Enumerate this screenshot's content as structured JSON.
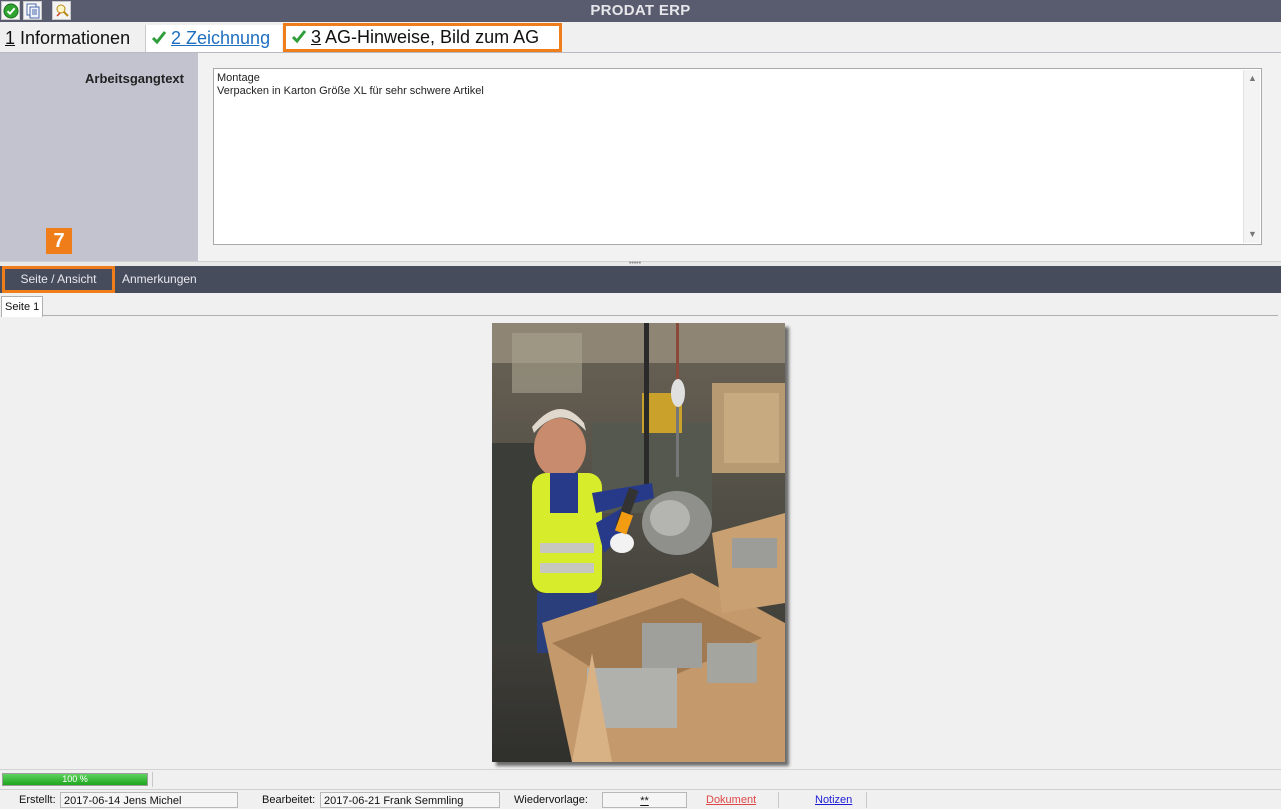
{
  "app": {
    "title": "PRODAT ERP"
  },
  "toolbar": {
    "icons": [
      "ok-check-icon",
      "copy-document-icon",
      "magnify-wand-icon"
    ]
  },
  "tabs": [
    {
      "number": "1",
      "label": " Informationen"
    },
    {
      "number": "2",
      "label": " Zeichnung"
    },
    {
      "number": "3",
      "label": " AG-Hinweise, Bild zum AG"
    }
  ],
  "form": {
    "field_label": "Arbeitsgangtext",
    "text_lines": [
      "Montage",
      "Verpacken in Karton Größe XL für sehr schwere Artikel"
    ]
  },
  "callout": {
    "number": "7"
  },
  "subtabs": {
    "view": "Seite / Ansicht",
    "notes": "Anmerkungen"
  },
  "page_tabs": {
    "page1": "Seite 1"
  },
  "progress": {
    "value_percent": 100,
    "label": "100 %"
  },
  "statusbar": {
    "created_label": "Erstellt:",
    "created_value": "2017-06-14  Jens Michel",
    "edited_label": "Bearbeitet:",
    "edited_value": "2017-06-21  Frank Semmling",
    "followup_label": "Wiedervorlage:",
    "followup_value": "**",
    "document_link": "Dokument",
    "notes_link": "Notizen"
  },
  "colors": {
    "accent": "#ef7d1a",
    "titlebar": "#585c6e",
    "subbar": "#474c5d",
    "side_panel": "#c3c3d0"
  }
}
